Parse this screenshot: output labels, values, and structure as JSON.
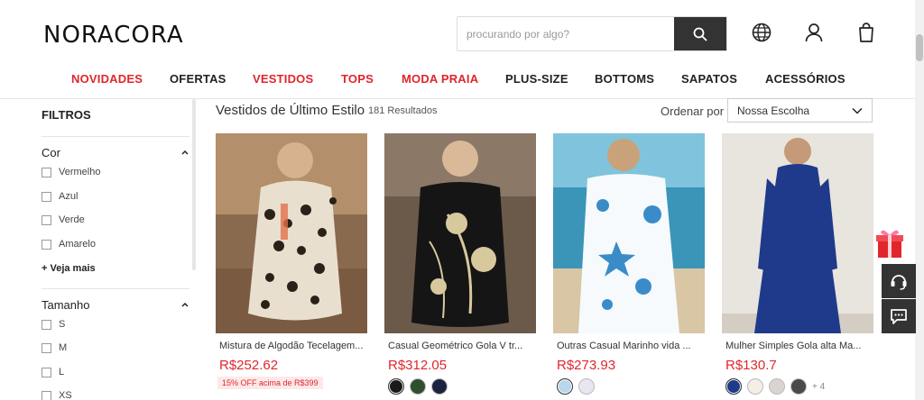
{
  "brand": "NORACORA",
  "search": {
    "placeholder": "procurando por algo?"
  },
  "header_icons": [
    "globe-icon",
    "user-icon",
    "bag-icon"
  ],
  "nav": [
    {
      "label": "NOVIDADES",
      "color": "#e0262c"
    },
    {
      "label": "OFERTAS",
      "color": "#222222"
    },
    {
      "label": "VESTIDOS",
      "color": "#e0262c"
    },
    {
      "label": "TOPS",
      "color": "#e0262c"
    },
    {
      "label": "MODA PRAIA",
      "color": "#e0262c"
    },
    {
      "label": "PLUS-SIZE",
      "color": "#222222"
    },
    {
      "label": "BOTTOMS",
      "color": "#222222"
    },
    {
      "label": "SAPATOS",
      "color": "#222222"
    },
    {
      "label": "ACESSÓRIOS",
      "color": "#222222"
    }
  ],
  "filters": {
    "title": "FILTROS",
    "color": {
      "heading": "Cor",
      "options": [
        "Vermelho",
        "Azul",
        "Verde",
        "Amarelo"
      ],
      "see_more": "+ Veja mais"
    },
    "size": {
      "heading": "Tamanho",
      "options": [
        "S",
        "M",
        "L",
        "XS"
      ]
    }
  },
  "listing": {
    "title": "Vestidos de Último Estilo",
    "results": "181 Resultados",
    "sort_label": "Ordenar por",
    "sort_value": "Nossa Escolha"
  },
  "products": [
    {
      "name": "Mistura de Algodão Tecelagem...",
      "price": "R$252.62",
      "promo": "15% OFF acima de R$399",
      "swatches": []
    },
    {
      "name": "Casual Geométrico Gola V tr...",
      "price": "R$312.05",
      "promo": "",
      "swatches": [
        "#1a1a1a",
        "#2f4f2f",
        "#1c2340"
      ]
    },
    {
      "name": "Outras Casual Marinho vida ...",
      "price": "R$273.93",
      "promo": "",
      "swatches": [
        "#b9d7ea",
        "#e9e6f2"
      ]
    },
    {
      "name": "Mulher Simples Gola alta Ma...",
      "price": "R$130.7",
      "promo": "",
      "swatches": [
        "#1f3a8a",
        "#f3eee6",
        "#d9d4cf",
        "#4a4a4a"
      ],
      "more": "+ 4"
    }
  ],
  "accent": "#e0262c"
}
